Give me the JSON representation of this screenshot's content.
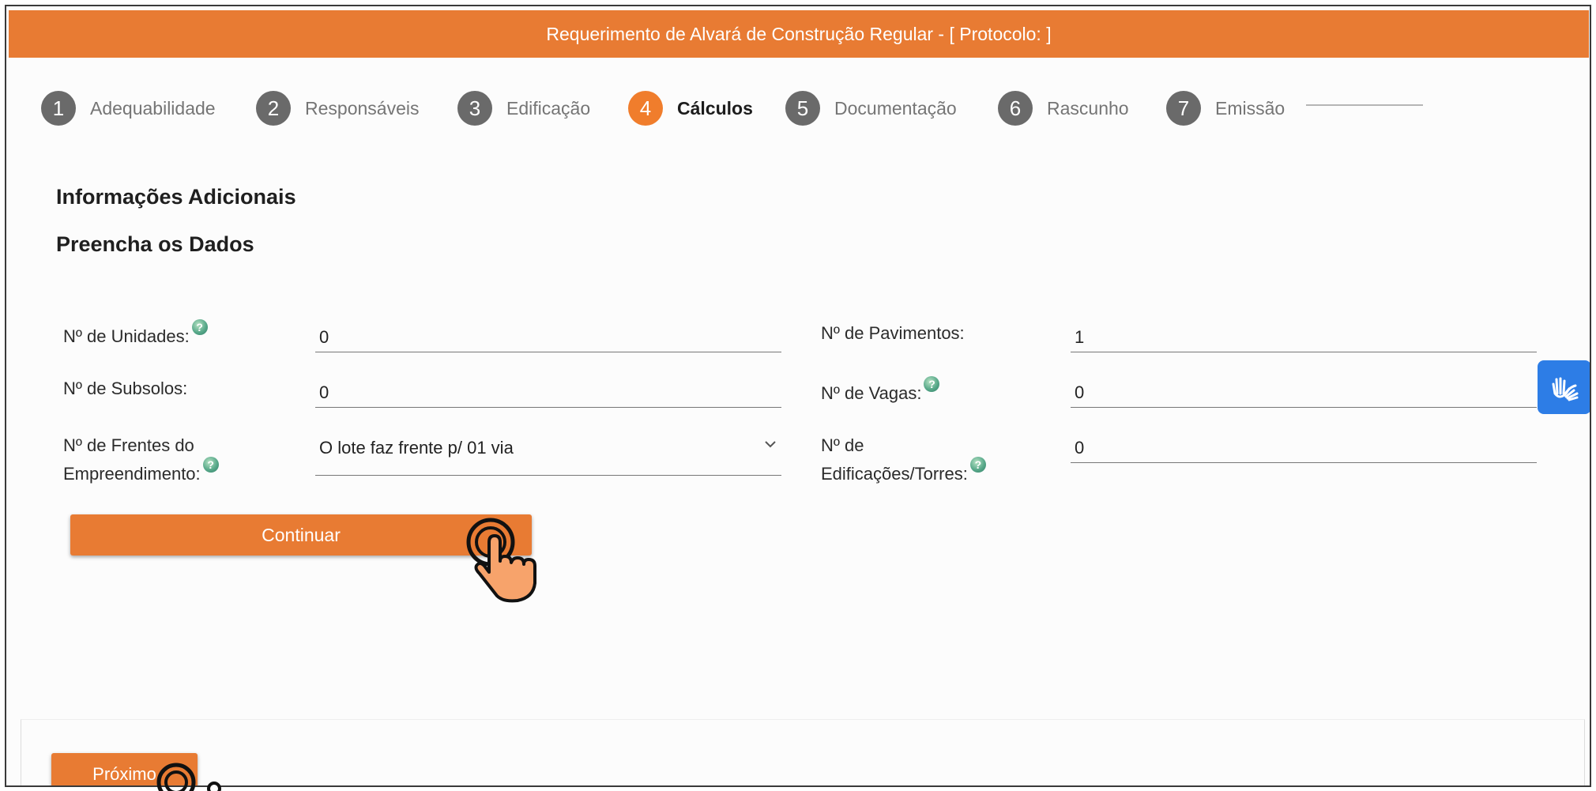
{
  "header": {
    "title": "Requerimento de Alvará de Construção Regular - [ Protocolo: ]"
  },
  "stepper": {
    "steps": [
      {
        "number": "1",
        "label": "Adequabilidade"
      },
      {
        "number": "2",
        "label": "Responsáveis"
      },
      {
        "number": "3",
        "label": "Edificação"
      },
      {
        "number": "4",
        "label": "Cálculos"
      },
      {
        "number": "5",
        "label": "Documentação"
      },
      {
        "number": "6",
        "label": "Rascunho"
      },
      {
        "number": "7",
        "label": "Emissão"
      }
    ],
    "active_step": "4"
  },
  "section": {
    "title": "Informações Adicionais",
    "subtitle": "Preencha os Dados"
  },
  "form": {
    "unidades": {
      "label": "Nº de Unidades:",
      "value": "0"
    },
    "subsolos": {
      "label": "Nº de Subsolos:",
      "value": "0"
    },
    "frentes": {
      "label_line1": "Nº de Frentes do",
      "label_line2": "Empreendimento:",
      "value": "O lote faz frente p/ 01 via"
    },
    "pavimentos": {
      "label": "Nº de Pavimentos:",
      "value": "1"
    },
    "vagas": {
      "label": "Nº de Vagas:",
      "value": "0"
    },
    "edificacoes": {
      "label_line1": "Nº de",
      "label_line2": "Edificações/Torres:",
      "value": "0"
    }
  },
  "buttons": {
    "continuar": "Continuar",
    "proximo": "Próximo"
  },
  "icons": {
    "help": "question-mark-icon",
    "chevron": "chevron-down-icon",
    "accessibility": "sign-language-icon",
    "cursor": "hand-pointer-icon"
  },
  "colors": {
    "accent": "#e87b33",
    "active_step": "#f07d2c",
    "inactive_step": "#6a6a6a",
    "accessibility_blue": "#2d7de6"
  }
}
